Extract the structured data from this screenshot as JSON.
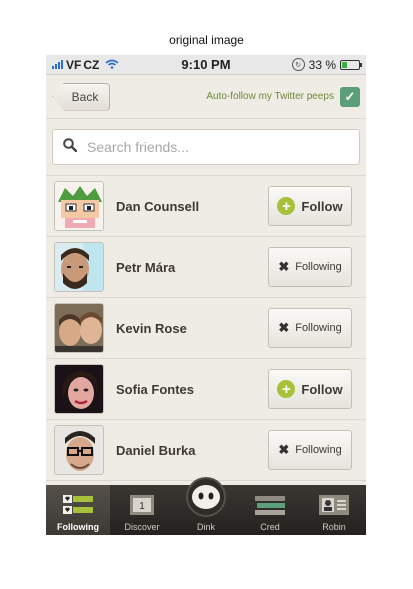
{
  "caption": "original image",
  "status": {
    "carrier": "CZ",
    "vf": "VF",
    "time": "9:10 PM",
    "battery": "33 %",
    "battery_level": 0.33
  },
  "nav": {
    "back_label": "Back",
    "autofollow_label": "Auto-follow my Twitter peeps",
    "autofollow_checked": true
  },
  "search": {
    "placeholder": "Search friends..."
  },
  "friends": [
    {
      "name": "Dan Counsell",
      "action": "Follow",
      "state": "follow",
      "avatar": "pixel-character"
    },
    {
      "name": "Petr Mára",
      "action": "Following",
      "state": "following",
      "avatar": "photo"
    },
    {
      "name": "Kevin Rose",
      "action": "Following",
      "state": "following",
      "avatar": "photo"
    },
    {
      "name": "Sofia Fontes",
      "action": "Follow",
      "state": "follow",
      "avatar": "photo"
    },
    {
      "name": "Daniel Burka",
      "action": "Following",
      "state": "following",
      "avatar": "photo"
    }
  ],
  "tabs": [
    {
      "label": "Following",
      "icon": "following-icon",
      "active": true
    },
    {
      "label": "Discover",
      "icon": "discover-icon",
      "active": false
    },
    {
      "label": "Dink",
      "icon": "dink-icon",
      "active": false
    },
    {
      "label": "Cred",
      "icon": "cred-icon",
      "active": false
    },
    {
      "label": "Robin",
      "icon": "profile-icon",
      "active": false
    }
  ],
  "colors": {
    "accent_green": "#a7c23a",
    "checkbox_green": "#5a9e7a",
    "background": "#efece6",
    "tabbar": "#2b2825"
  }
}
